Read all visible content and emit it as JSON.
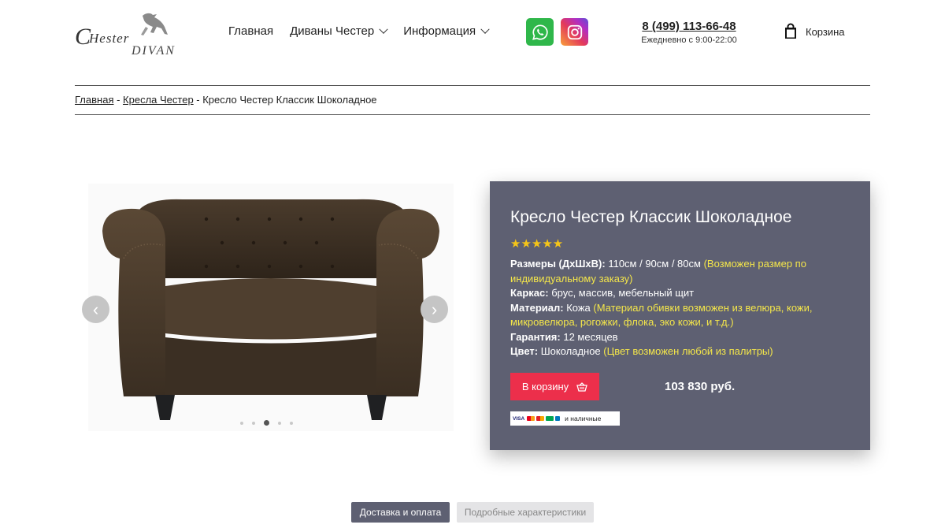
{
  "logo": {
    "line1": "CHESTER",
    "line2": "DIVAN"
  },
  "nav": {
    "items": [
      {
        "label": "Главная",
        "has_dropdown": false
      },
      {
        "label": "Диваны Честер",
        "has_dropdown": true
      },
      {
        "label": "Информация",
        "has_dropdown": true
      }
    ]
  },
  "social": {
    "whatsapp_icon": "whatsapp-icon",
    "instagram_icon": "instagram-icon",
    "whatsapp_color": "#2fb74a"
  },
  "contact": {
    "phone": "8 (499) 113-66-48",
    "hours": "Ежедневно с 9:00-22:00"
  },
  "cart": {
    "label": "Корзина",
    "icon": "shopping-bag-icon"
  },
  "breadcrumb": {
    "items": [
      "Главная",
      "Кресла Честер"
    ],
    "separator": " - ",
    "current": "Кресло Честер Классик Шоколадное"
  },
  "gallery": {
    "slide_count": 5,
    "active_slide": 3,
    "prev_arrow": "‹",
    "next_arrow": "›"
  },
  "product": {
    "title": "Кресло Честер Классик Шоколадное",
    "rating_stars": "★★★★★",
    "specs": [
      {
        "label": "Размеры (ДхШхВ):",
        "value": "110см / 90см / 80см",
        "note": "(Возможен размер по индивидуальному заказу)"
      },
      {
        "label": "Каркас:",
        "value": "брус, массив, мебельный щит",
        "note": ""
      },
      {
        "label": "Материал:",
        "value": "Кожа",
        "note": "(Материал обивки возможен из велюра, кожи, микровелюра, рогожки, флока, эко кожи, и т.д.)"
      },
      {
        "label": "Гарантия:",
        "value": "12 месяцев",
        "note": ""
      },
      {
        "label": "Цвет:",
        "value": "Шоколадное",
        "note": "(Цвет возможен любой из палитры)"
      }
    ],
    "add_to_cart_label": "В корзину",
    "price": "103 830 руб.",
    "payment": {
      "visa": "VISA",
      "cash_label": "и наличные"
    }
  },
  "tabs": [
    {
      "label": "Доставка и оплата",
      "active": true
    },
    {
      "label": "Подробные характеристики",
      "active": false
    }
  ],
  "colors": {
    "panel": "#5e6072",
    "accent_red": "#ec2f4b",
    "highlight": "#f4e64a",
    "stars": "#f5c518"
  }
}
